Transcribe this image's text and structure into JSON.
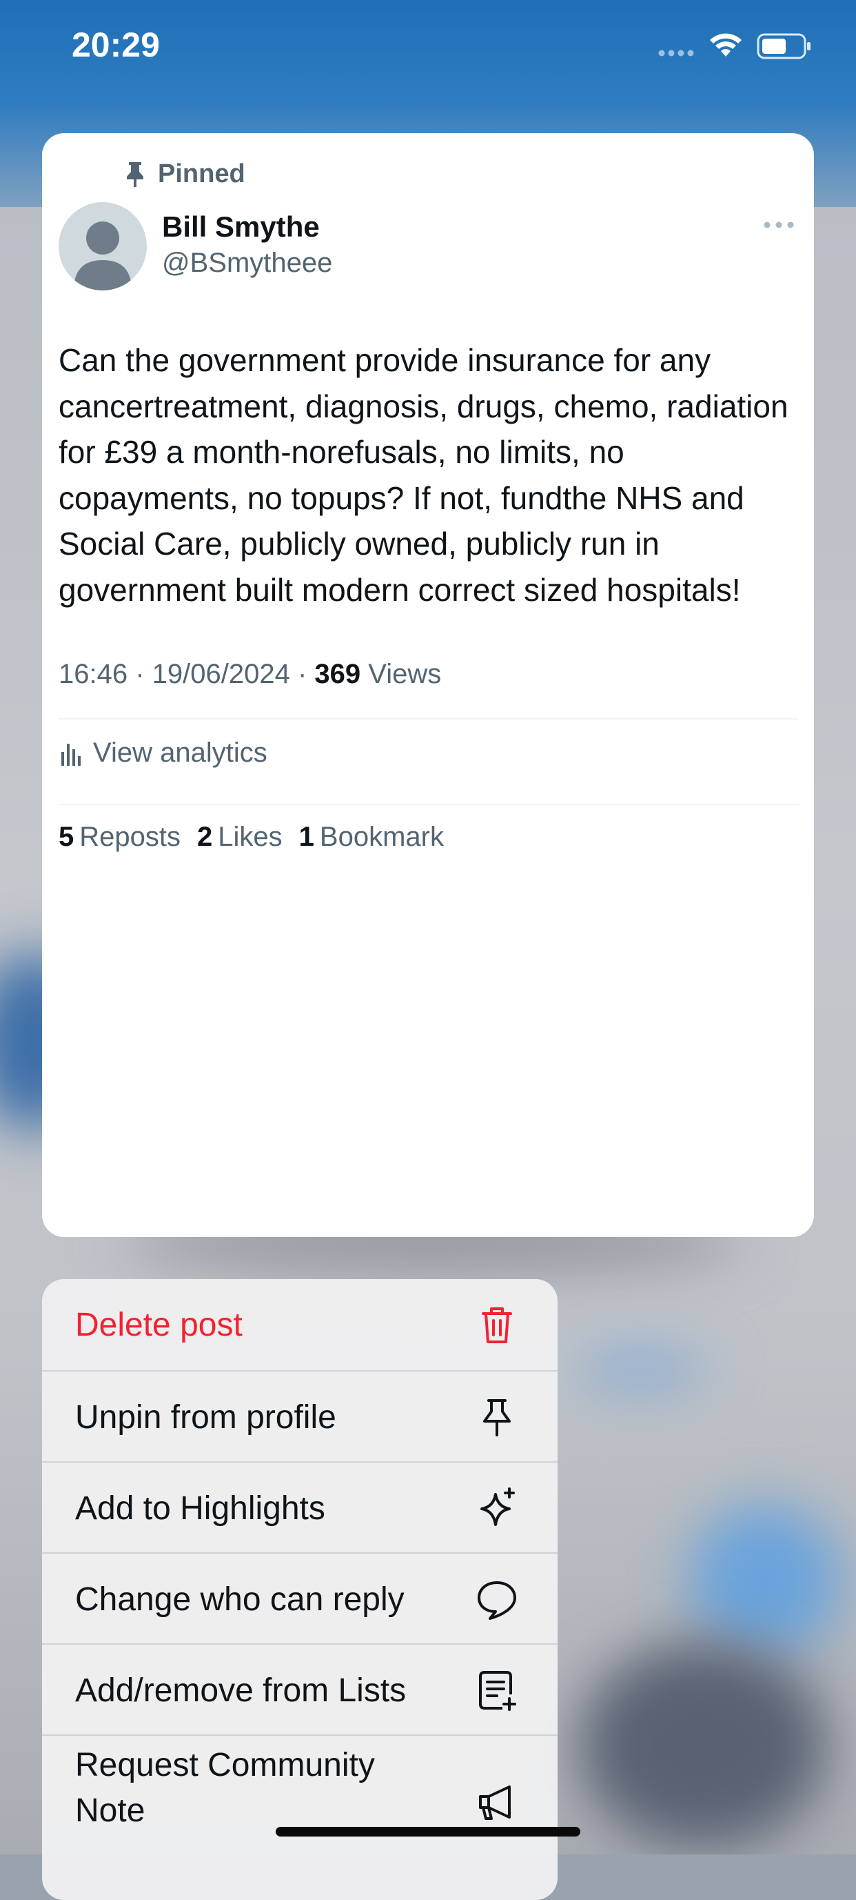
{
  "status_bar": {
    "time": "20:29"
  },
  "post": {
    "pinned_label": "Pinned",
    "author_name": "Bill Smythe",
    "author_handle": "@BSmytheee",
    "text": "Can the government provide insurance for any cancertreatment, diagnosis, drugs, chemo, radiation for £39 a month-norefusals, no limits, no copayments,  no topups? If not, fundthe NHS and Social Care, publicly owned, publicly run in government built modern correct sized hospitals!",
    "time": "16:46",
    "date": "19/06/2024",
    "views_count": "369",
    "views_label": "Views",
    "view_analytics": "View analytics",
    "reposts_count": "5",
    "reposts_label": "Reposts",
    "likes_count": "2",
    "likes_label": "Likes",
    "bookmarks_count": "1",
    "bookmarks_label": "Bookmark"
  },
  "menu": {
    "items": [
      {
        "label": "Delete post",
        "icon": "trash-icon",
        "danger": true
      },
      {
        "label": "Unpin from profile",
        "icon": "pin-icon"
      },
      {
        "label": "Add to Highlights",
        "icon": "sparkle-icon"
      },
      {
        "label": "Change who can reply",
        "icon": "speech-bubble-icon"
      },
      {
        "label": "Add/remove from Lists",
        "icon": "list-add-icon"
      },
      {
        "label": "Request Community Note",
        "icon": "megaphone-icon"
      }
    ]
  },
  "colors": {
    "danger": "#f4212e",
    "secondary_text": "#536471",
    "primary_text": "#0f1419"
  }
}
